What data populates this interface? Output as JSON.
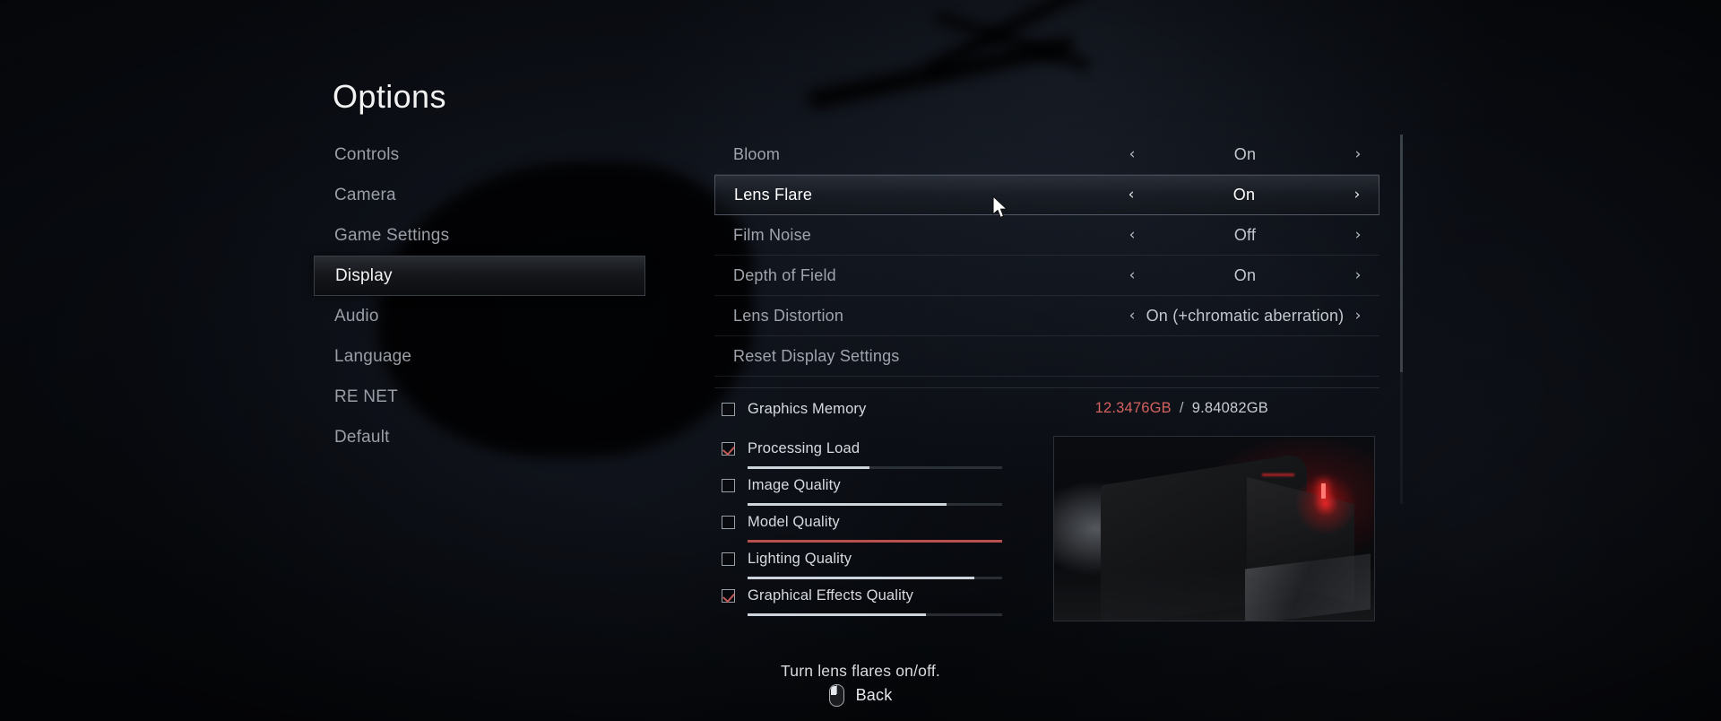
{
  "page_title": "Options",
  "sidebar": {
    "items": [
      {
        "label": "Controls",
        "selected": false
      },
      {
        "label": "Camera",
        "selected": false
      },
      {
        "label": "Game Settings",
        "selected": false
      },
      {
        "label": "Display",
        "selected": true
      },
      {
        "label": "Audio",
        "selected": false
      },
      {
        "label": "Language",
        "selected": false
      },
      {
        "label": "RE NET",
        "selected": false
      },
      {
        "label": "Default",
        "selected": false
      }
    ]
  },
  "settings": {
    "left_arrow": "‹",
    "right_arrow": "›",
    "rows": [
      {
        "label": "Bloom",
        "value": "On",
        "selected": false,
        "has_value": true
      },
      {
        "label": "Lens Flare",
        "value": "On",
        "selected": true,
        "has_value": true
      },
      {
        "label": "Film Noise",
        "value": "Off",
        "selected": false,
        "has_value": true
      },
      {
        "label": "Depth of Field",
        "value": "On",
        "selected": false,
        "has_value": true
      },
      {
        "label": "Lens Distortion",
        "value": "On (+chromatic aberration)",
        "selected": false,
        "has_value": true
      },
      {
        "label": "Reset Display Settings",
        "value": "",
        "selected": false,
        "has_value": false
      }
    ]
  },
  "stats": {
    "graphics_memory": {
      "label": "Graphics Memory",
      "checked": false,
      "used": "12.3476GB",
      "separator": "/",
      "total": "9.84082GB",
      "used_color": "#d4625f"
    },
    "bars": [
      {
        "label": "Processing Load",
        "checked": true,
        "percent": 48,
        "color": "#cdd3da"
      },
      {
        "label": "Image Quality",
        "checked": false,
        "percent": 78,
        "color": "#cdd3da"
      },
      {
        "label": "Model Quality",
        "checked": false,
        "percent": 100,
        "color": "#b8504e"
      },
      {
        "label": "Lighting Quality",
        "checked": false,
        "percent": 89,
        "color": "#cdd3da"
      },
      {
        "label": "Graphical Effects Quality",
        "checked": true,
        "percent": 70,
        "color": "#cdd3da"
      }
    ]
  },
  "footer": {
    "description": "Turn lens flares on/off.",
    "back_label": "Back",
    "back_icon": "right-mouse-button-icon"
  }
}
